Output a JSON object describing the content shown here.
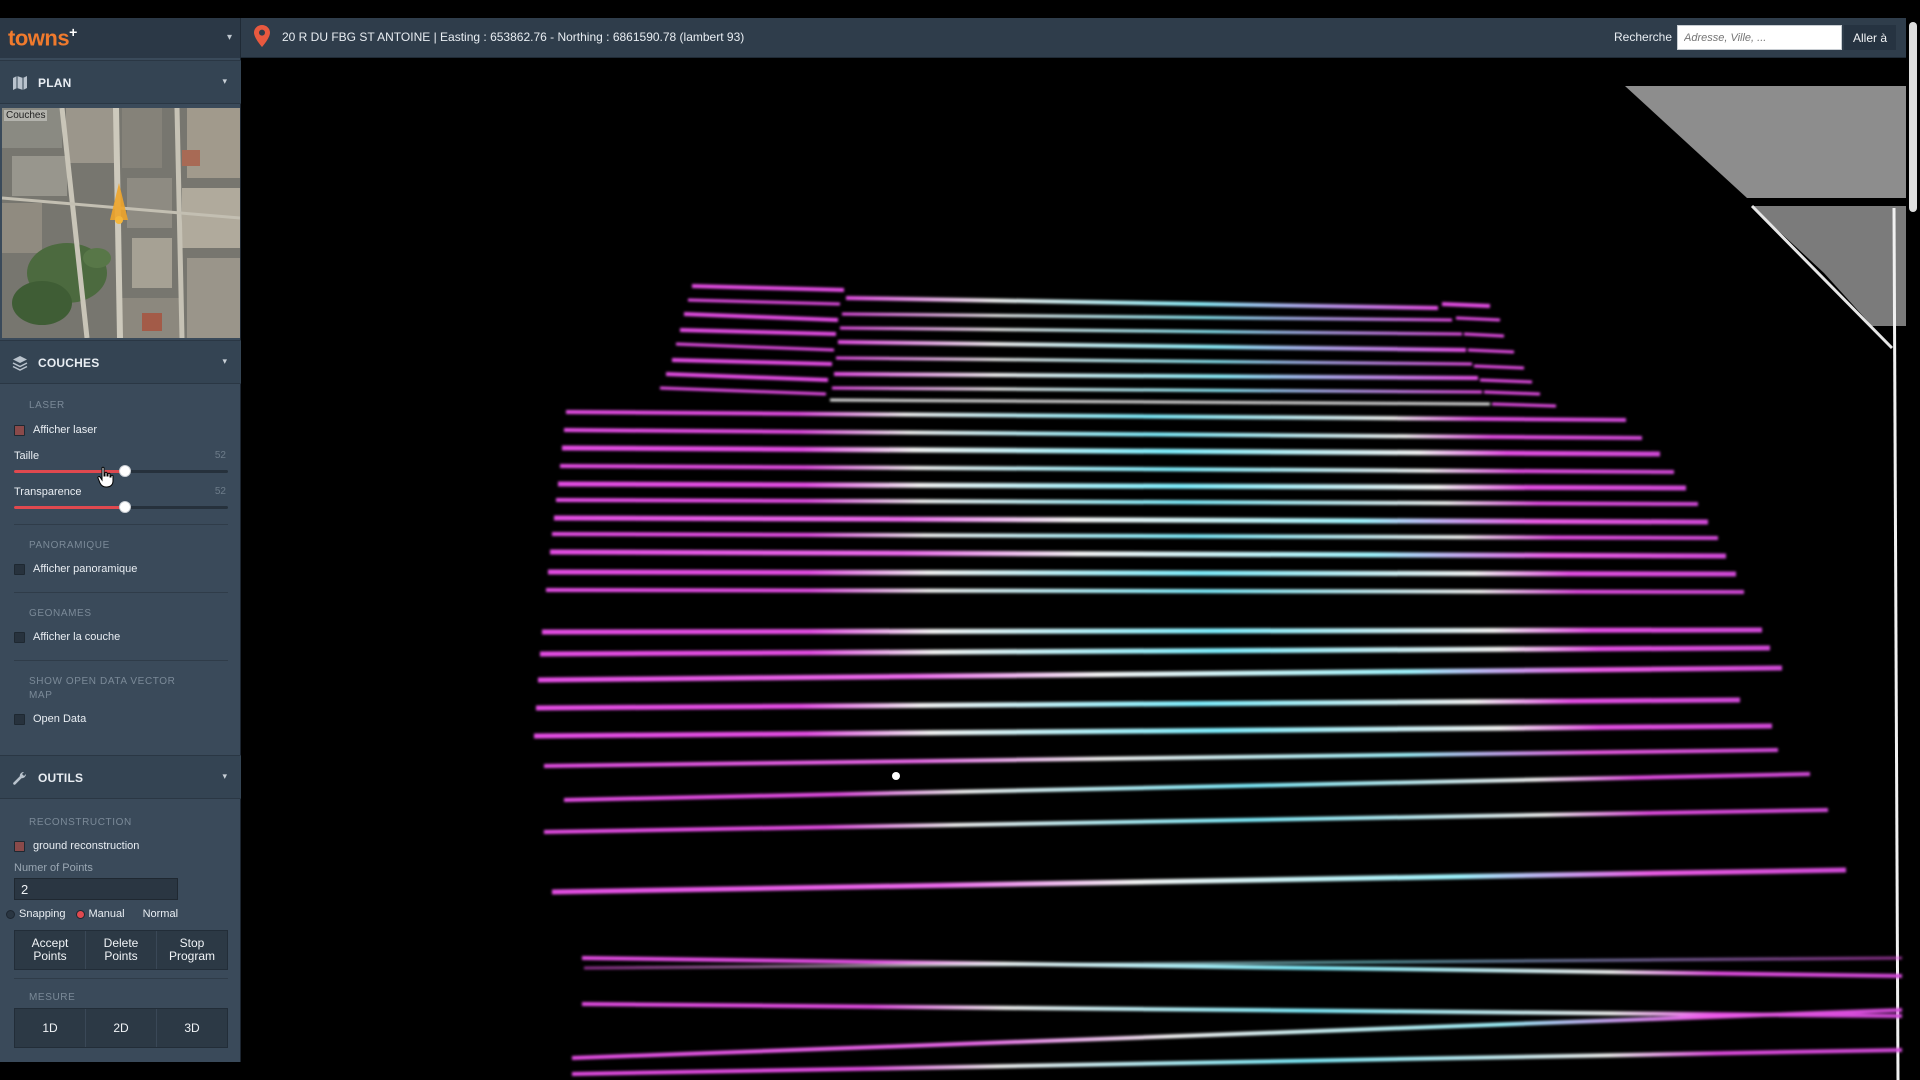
{
  "app": {
    "logo": "towns",
    "logo_sup": "+"
  },
  "header": {
    "address": "20 R DU FBG ST ANTOINE | Easting : 653862.76 - Northing : 6861590.78 (lambert 93)",
    "search_label": "Recherche",
    "search_placeholder": "Adresse, Ville, ...",
    "go_button": "Aller à"
  },
  "sidebar": {
    "plan": {
      "title": "PLAN",
      "map_label": "Couches"
    },
    "couches": {
      "title": "COUCHES",
      "laser": {
        "group": "LASER",
        "checkbox": "Afficher laser",
        "size_label": "Taille",
        "size_value": "52",
        "size_fraction": 0.52,
        "transparency_label": "Transparence",
        "transparency_value": "52",
        "transparency_fraction": 0.52
      },
      "panoramique": {
        "group": "PANORAMIQUE",
        "checkbox": "Afficher panoramique"
      },
      "geonames": {
        "group": "GEONAMES",
        "checkbox": "Afficher la couche"
      },
      "opendata": {
        "group": "SHOW OPEN DATA VECTOR MAP",
        "checkbox": "Open Data"
      }
    },
    "outils": {
      "title": "OUTILS",
      "reconstruction": {
        "group": "RECONSTRUCTION",
        "checkbox": "ground reconstruction",
        "num_label": "Numer of Points",
        "num_value": "2",
        "radios": [
          "Snapping",
          "Manual",
          "Normal"
        ],
        "buttons": [
          "Accept Points",
          "Delete Points",
          "Stop Program"
        ]
      },
      "mesure": {
        "group": "MESURE",
        "buttons": [
          "1D",
          "2D",
          "3D"
        ]
      }
    }
  },
  "colors": {
    "accent": "#e0494f",
    "logo": "#f07a2d",
    "sidebar": "#3a4a5a",
    "header": "#2f3d4b",
    "laser_magenta": "#e64ee6",
    "laser_cyan": "#6ff2ff"
  }
}
